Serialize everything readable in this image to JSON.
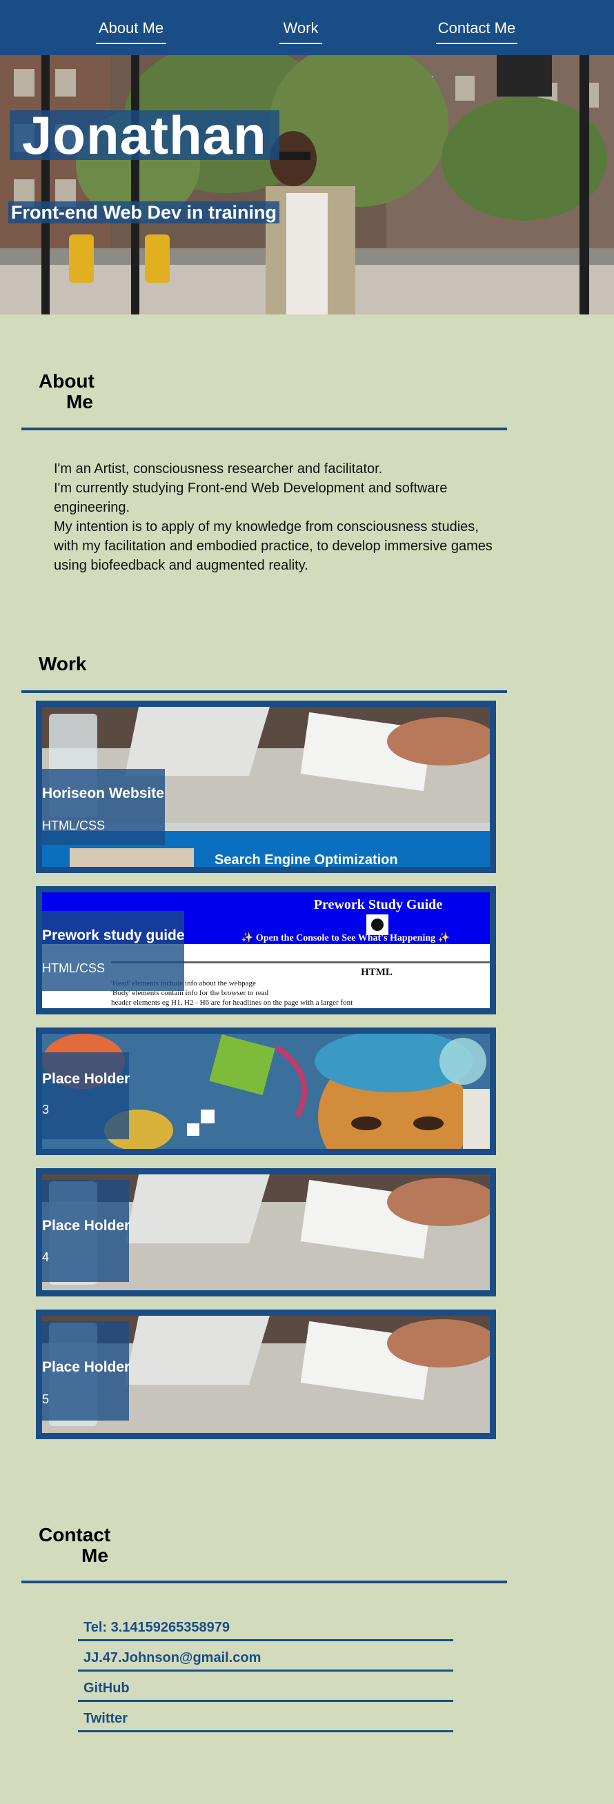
{
  "nav": {
    "about": "About Me",
    "work": "Work",
    "contact": "Contact Me"
  },
  "hero": {
    "name": "Jonathan",
    "tagline": "Front-end Web Dev in training"
  },
  "about": {
    "title_line1": "About",
    "title_line2": "Me",
    "paragraphs": [
      "I'm an Artist, consciousness researcher and facilitator.",
      "I'm currently studying Front-end Web Development and software engineering.",
      "My intention is to apply of my knowledge from consciousness studies, with my facilitation and embodied practice, to develop immersive games using biofeedback and augmented reality."
    ]
  },
  "work": {
    "title": "Work",
    "projects": [
      {
        "title": "Horiseon Website",
        "subtitle": "HTML/CSS",
        "screenshot_text": "Search Engine Optimization"
      },
      {
        "title": "Prework study guide",
        "subtitle": "HTML/CSS",
        "screenshot_text": {
          "heading": "Prework Study Guide",
          "banner": "✨ Open the Console to See What's Happening ✨",
          "section": "HTML",
          "bullets": [
            "'Head' elements include info about the webpage",
            "'Body' elements contain info for the browser to read",
            "header elements eg H1, H2 - H6 are for headlines on the page with a larger font"
          ]
        }
      },
      {
        "title": "Place Holder",
        "subtitle": "3"
      },
      {
        "title": "Place Holder",
        "subtitle": "4"
      },
      {
        "title": "Place Holder",
        "subtitle": "5"
      }
    ]
  },
  "contact": {
    "title_line1": "Contact",
    "title_line2": "Me",
    "items": [
      "Tel: 3.14159265358979",
      "JJ.47.Johnson@gmail.com",
      "GitHub",
      "Twitter"
    ]
  },
  "colors": {
    "brand": "#1a4d86",
    "background": "#d2dbbb"
  }
}
